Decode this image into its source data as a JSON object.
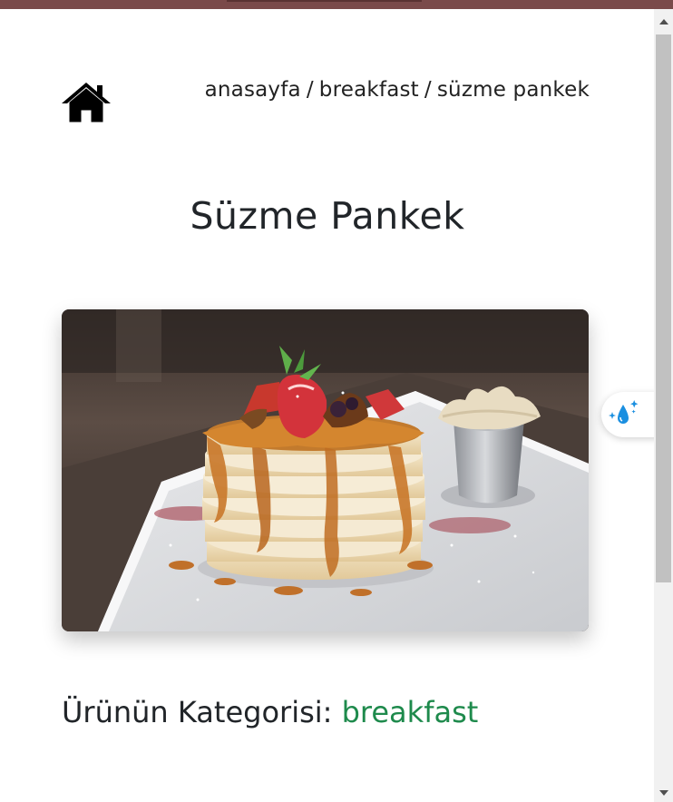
{
  "browser": {
    "top_bar_color": "#7a4a4a"
  },
  "header": {
    "home_icon": "house-icon",
    "breadcrumb": {
      "home": "anasayfa",
      "separator": "/",
      "category": "breakfast",
      "current": "süzme pankek"
    }
  },
  "product": {
    "title": "Süzme Pankek",
    "image_subject": "pancake-stack-photo",
    "category_label": "Ürünün Kategorisi:",
    "category_value": "breakfast",
    "category_color": "#1e8a4c"
  },
  "floating_widget": {
    "icon": "water-drop-sparkle-icon",
    "accent": "#1a8fe0"
  }
}
